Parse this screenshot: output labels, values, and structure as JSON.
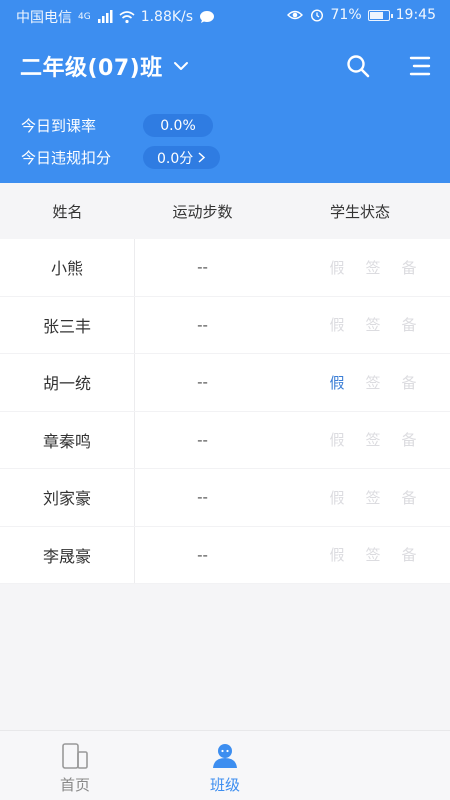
{
  "status_bar": {
    "carrier": "中国电信",
    "network": "4G",
    "speed": "1.88K/s",
    "battery": "71%",
    "time": "19:45"
  },
  "header": {
    "class_title": "二年级(07)班",
    "attendance_label": "今日到课率",
    "attendance_value": "0.0%",
    "violation_label": "今日违规扣分",
    "violation_value": "0.0分"
  },
  "table": {
    "columns": [
      "姓名",
      "运动步数",
      "学生状态"
    ],
    "status_tags": [
      "假",
      "签",
      "备"
    ],
    "rows": [
      {
        "name": "小熊",
        "steps": "--",
        "active_tag": ""
      },
      {
        "name": "张三丰",
        "steps": "--",
        "active_tag": ""
      },
      {
        "name": "胡一统",
        "steps": "--",
        "active_tag": "假"
      },
      {
        "name": "章秦鸣",
        "steps": "--",
        "active_tag": ""
      },
      {
        "name": "刘家豪",
        "steps": "--",
        "active_tag": ""
      },
      {
        "name": "李晟豪",
        "steps": "--",
        "active_tag": ""
      }
    ]
  },
  "tabbar": {
    "home_label": "首页",
    "class_label": "班级",
    "active": "班级"
  },
  "colors": {
    "primary": "#3d8ef0",
    "pill": "#2f7ce2",
    "active_tag": "#3d7fd6",
    "inactive_tag": "#dcdce0"
  }
}
